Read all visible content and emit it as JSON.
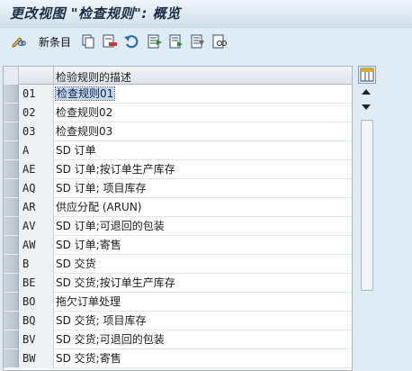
{
  "window": {
    "title": "更改视图 \"检查规则\": 概览"
  },
  "toolbar": {
    "new_entries_label": "新条目",
    "icons": [
      "edit-glasses-icon",
      "copy-icon",
      "delete-icon",
      "undo-icon",
      "select-all-icon",
      "select-block-icon",
      "deselect-icon",
      "find-icon"
    ]
  },
  "table": {
    "column_header": "检验规则的描述",
    "rows": [
      {
        "key": "01",
        "desc": "检查规则01"
      },
      {
        "key": "02",
        "desc": "检查规则02"
      },
      {
        "key": "03",
        "desc": "检查规则03"
      },
      {
        "key": "A",
        "desc": "SD 订单"
      },
      {
        "key": "AE",
        "desc": "SD 订单;按订单生产库存"
      },
      {
        "key": "AQ",
        "desc": "SD 订单; 项目库存"
      },
      {
        "key": "AR",
        "desc": "供应分配 (ARUN)"
      },
      {
        "key": "AV",
        "desc": "SD 订单;可退回的包装"
      },
      {
        "key": "AW",
        "desc": "SD 订单;寄售"
      },
      {
        "key": "B",
        "desc": "SD 交货"
      },
      {
        "key": "BE",
        "desc": "SD 交货;按订单生产库存"
      },
      {
        "key": "BO",
        "desc": "拖欠订单处理"
      },
      {
        "key": "BQ",
        "desc": "SD 交货; 项目库存"
      },
      {
        "key": "BV",
        "desc": "SD 交货;可退回的包装"
      },
      {
        "key": "BW",
        "desc": "SD 交货;寄售"
      }
    ],
    "selected_row": 0
  },
  "colors": {
    "background": "#dfebf5",
    "title_text": "#1b2e44",
    "selection": "#c6d8ea"
  }
}
